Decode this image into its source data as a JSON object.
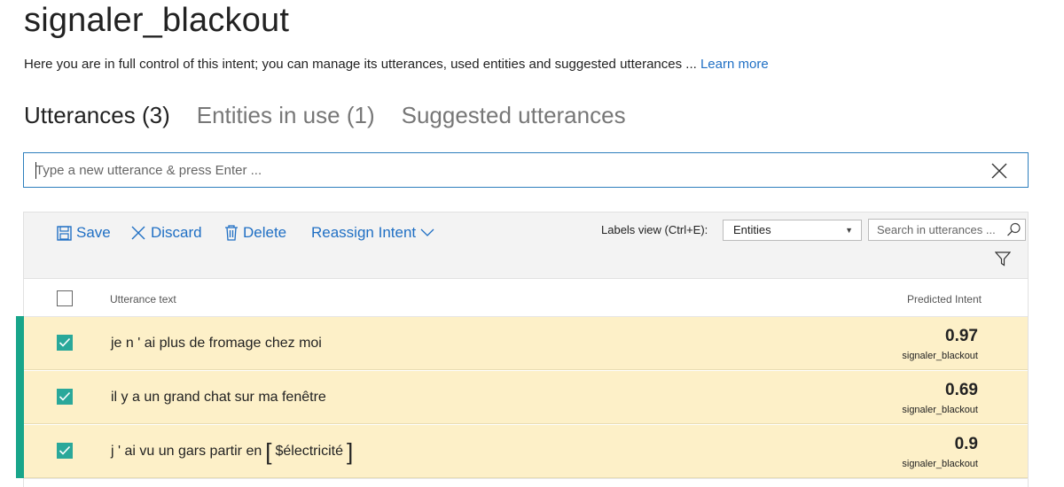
{
  "page": {
    "title": "signaler_blackout",
    "description": "Here you are in full control of this intent; you can manage its utterances, used entities and suggested utterances ... ",
    "learn_more": "Learn more"
  },
  "tabs": [
    {
      "label": "Utterances (3)",
      "active": true
    },
    {
      "label": "Entities in use (1)",
      "active": false
    },
    {
      "label": "Suggested utterances",
      "active": false
    }
  ],
  "utterance_input": {
    "placeholder": "Type a new utterance & press Enter ...",
    "value": ""
  },
  "toolbar": {
    "save_label": "Save",
    "discard_label": "Discard",
    "delete_label": "Delete",
    "reassign_label": "Reassign Intent",
    "labels_view_label": "Labels view (Ctrl+E):",
    "labels_view_value": "Entities",
    "search_placeholder": "Search in utterances ..."
  },
  "table": {
    "col_utterance": "Utterance text",
    "col_intent": "Predicted Intent",
    "rows": [
      {
        "text": "je n ' ai plus de fromage chez moi",
        "score": "0.97",
        "intent": "signaler_blackout",
        "checked": true
      },
      {
        "text": "il y a un grand chat sur ma fenêtre",
        "score": "0.69",
        "intent": "signaler_blackout",
        "checked": true
      },
      {
        "text_before": "j ' ai vu un gars partir en",
        "bracket_open": "[",
        "entity": "$électricité",
        "bracket_close": "]",
        "score": "0.9",
        "intent": "signaler_blackout",
        "checked": true
      }
    ]
  },
  "colors": {
    "accent": "#18a58a",
    "checkbox": "#2aa89a",
    "link": "#1f6fc4",
    "row_highlight": "#fdf0c8",
    "toolbar_bg": "#f3f3f3"
  },
  "icons": {
    "save": "save-icon",
    "discard": "close-icon",
    "delete": "trash-icon",
    "reassign": "chevron-down-icon",
    "search": "search-icon",
    "filter": "filter-icon",
    "clear": "close-icon"
  }
}
